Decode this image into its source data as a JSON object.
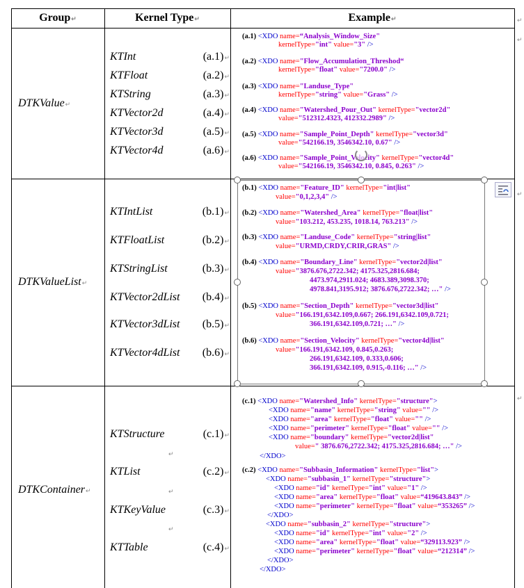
{
  "header": {
    "group": "Group",
    "kernel_type": "Kernel Type",
    "example": "Example"
  },
  "groups": [
    {
      "name": "DTKValue",
      "kernels": [
        {
          "name": "KTInt",
          "label": "(a.1)"
        },
        {
          "name": "KTFloat",
          "label": "(a.2)"
        },
        {
          "name": "KTString",
          "label": "(a.3)"
        },
        {
          "name": "KTVector2d",
          "label": "(a.4)"
        },
        {
          "name": "KTVector3d",
          "label": "(a.5)"
        },
        {
          "name": "KTVector4d",
          "label": "(a.6)"
        }
      ],
      "examples": [
        {
          "id": "(a.1)",
          "name": "“Analysis_Window_Size\"",
          "kernelType": "\"int\"",
          "value": "\"3\"",
          "inline": false
        },
        {
          "id": "(a.2)",
          "name": "\"Flow_Accumulation_Threshod“",
          "kernelType": "\"float\"",
          "value": "\"7200.0\"",
          "inline": false
        },
        {
          "id": "(a.3)",
          "name": "\"Landuse_Type\"",
          "kernelType": "\"string\"",
          "value": "\"Grass\"",
          "inline": false
        },
        {
          "id": "(a.4)",
          "name": "\"Watershed_Pour_Out\"",
          "kernelType": "\"vector2d\"",
          "value": "\"512312.4323, 412332.2989\"",
          "inline": true
        },
        {
          "id": "(a.5)",
          "name": "\"Sample_Point_Depth\"",
          "kernelType": "\"vector3d\"",
          "value": "\"542166.19, 3546342.10, 0.67\"",
          "inline": true
        },
        {
          "id": "(a.6)",
          "name": "\"Sample_Point_Velocity\"",
          "kernelType": "\"vector4d\"",
          "value": "\"542166.19, 3546342.10, 0.845, 0.263\"",
          "inline": true
        }
      ]
    },
    {
      "name": "DTKValueList",
      "kernels": [
        {
          "name": "KTIntList",
          "label": "(b.1)"
        },
        {
          "name": "KTFloatList",
          "label": "(b.2)"
        },
        {
          "name": "KTStringList",
          "label": "(b.3)"
        },
        {
          "name": "KTVector2dList",
          "label": "(b.4)"
        },
        {
          "name": "KTVector3dList",
          "label": "(b.5)"
        },
        {
          "name": "KTVector4dList",
          "label": "(b.6)"
        }
      ],
      "examples": [
        {
          "id": "(b.1)",
          "name": "\"Feature_ID\"",
          "kernelType": "\"int|list\"",
          "value_lines": [
            "\"0,1,2,3,4\""
          ]
        },
        {
          "id": "(b.2)",
          "name": "\"Watershed_Area\"",
          "kernelType": "\"float|list\"",
          "value_lines": [
            "\"103.212, 453.235, 1018.14, 763.213\""
          ]
        },
        {
          "id": "(b.3)",
          "name": "\"Landuse_Code\"",
          "kernelType": "\"string|list\"",
          "value_lines": [
            "\"URMD,CRDY,CRIR,GRAS\""
          ]
        },
        {
          "id": "(b.4)",
          "name": "\"Boundary_Line\"",
          "kernelType": "\"vector2d|list\"",
          "value_lines": [
            "\"3876.676,2722.342; 4175.325,2816.684;",
            "4473.974,2911.024; 4683.389,3098.370;",
            "4978.841,3195.912; 3876.676,2722.342; …\""
          ]
        },
        {
          "id": "(b.5)",
          "name": "\"Section_Depth\"",
          "kernelType": "\"vector3d|list\"",
          "value_lines": [
            "\"166.191,6342.109,0.667; 266.191,6342.109,0.721;",
            "366.191,6342.109,0.721; …\""
          ]
        },
        {
          "id": "(b.6)",
          "name": "\"Section_Velocity\"",
          "kernelType": "\"vector4d|list\"",
          "value_lines": [
            "\"166.191,6342.109, 0.845,0.263;",
            "266.191,6342.109, 0.333,0.606;",
            "366.191,6342.109, 0.915,-0.116; …\""
          ]
        }
      ]
    },
    {
      "name": "DTKContainer",
      "kernels": [
        {
          "name": "KTStructure",
          "label": "(c.1)"
        },
        {
          "name": "KTList",
          "label": "(c.2)"
        },
        {
          "name": "KTKeyValue",
          "label": "(c.3)"
        },
        {
          "name": "KTTable",
          "label": "(c.4)"
        }
      ],
      "c1": {
        "id": "(c.1)",
        "outer": {
          "name": "\"Watershed_Info\"",
          "kernelType": "\"structure\""
        },
        "children": [
          {
            "name": "\"name\"",
            "kernelType": "\"string\"",
            "value": "\"\""
          },
          {
            "name": "\"area\"",
            "kernelType": "\"float\"",
            "value": "\"\""
          },
          {
            "name": "\"perimeter\"",
            "kernelType": "\"float\"",
            "value": "\"\""
          },
          {
            "name": "\"boundary\"",
            "kernelType": "\"vector2d|list\"",
            "value": "\" 3876.676,2722.342; 4175.325,2816.684; …\""
          }
        ]
      },
      "c2": {
        "id": "(c.2)",
        "outer": {
          "name": "\"Subbasin_Information\"",
          "kernelType": "\"list\""
        },
        "subbasins": [
          {
            "name": "\"subbasin_1\"",
            "kernelType": "\"structure\"",
            "children": [
              {
                "name": "\"id\"",
                "kernelType": "\"int\"",
                "value": "\"1\""
              },
              {
                "name": "\"area\"",
                "kernelType": "\"float\"",
                "value": "“419643.843”"
              },
              {
                "name": "\"perimeter\"",
                "kernelType": "\"float\"",
                "value": "“353265”"
              }
            ]
          },
          {
            "name": "\"subbasin_2\"",
            "kernelType": "\"structure\"",
            "children": [
              {
                "name": "\"id\"",
                "kernelType": "\"int\"",
                "value": "\"2\""
              },
              {
                "name": "\"area\"",
                "kernelType": "\"float\"",
                "value": "“329113.923”"
              },
              {
                "name": "\"perimeter\"",
                "kernelType": "\"float\"",
                "value": "“212314”"
              }
            ]
          }
        ]
      }
    }
  ],
  "syntax": {
    "open_tag": "<XDO",
    "close_tag": "/>",
    "end_open": ">",
    "close_element": "</XDO>",
    "attr_name": "name=",
    "attr_kernel": "kernelType=",
    "attr_value": "value="
  },
  "marks": {
    "paragraph": "↵"
  },
  "colors": {
    "tag": "#0000cc",
    "attribute": "#ff0000",
    "value": "#8b00cc",
    "border": "#000000"
  }
}
